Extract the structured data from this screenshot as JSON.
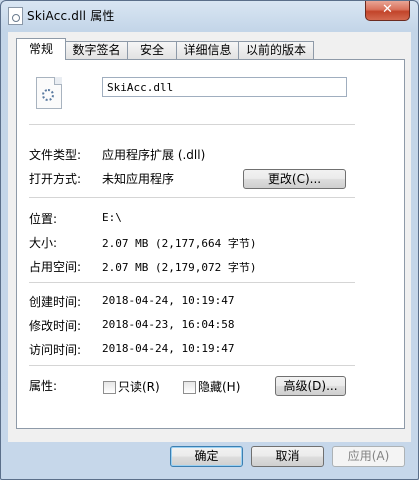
{
  "window": {
    "title": "SkiAcc.dll 属性",
    "close_glyph": "✕"
  },
  "tabs": [
    {
      "label": "常规"
    },
    {
      "label": "数字签名"
    },
    {
      "label": "安全"
    },
    {
      "label": "详细信息"
    },
    {
      "label": "以前的版本"
    }
  ],
  "general": {
    "file_name": "SkiAcc.dll",
    "file_type_label": "文件类型:",
    "file_type_value": "应用程序扩展 (.dll)",
    "open_with_label": "打开方式:",
    "open_with_value": "未知应用程序",
    "change_button": "更改(C)...",
    "location_label": "位置:",
    "location_value": "E:\\",
    "size_label": "大小:",
    "size_value": "2.07 MB (2,177,664 字节)",
    "size_on_disk_label": "占用空间:",
    "size_on_disk_value": "2.07 MB (2,179,072 字节)",
    "created_label": "创建时间:",
    "created_value": "2018-04-24, 10:19:47",
    "modified_label": "修改时间:",
    "modified_value": "2018-04-23, 16:04:58",
    "accessed_label": "访问时间:",
    "accessed_value": "2018-04-24, 10:19:47",
    "attributes_label": "属性:",
    "readonly_label": "只读(R)",
    "hidden_label": "隐藏(H)",
    "advanced_button": "高级(D)..."
  },
  "footer": {
    "ok": "确定",
    "cancel": "取消",
    "apply": "应用(A)"
  }
}
